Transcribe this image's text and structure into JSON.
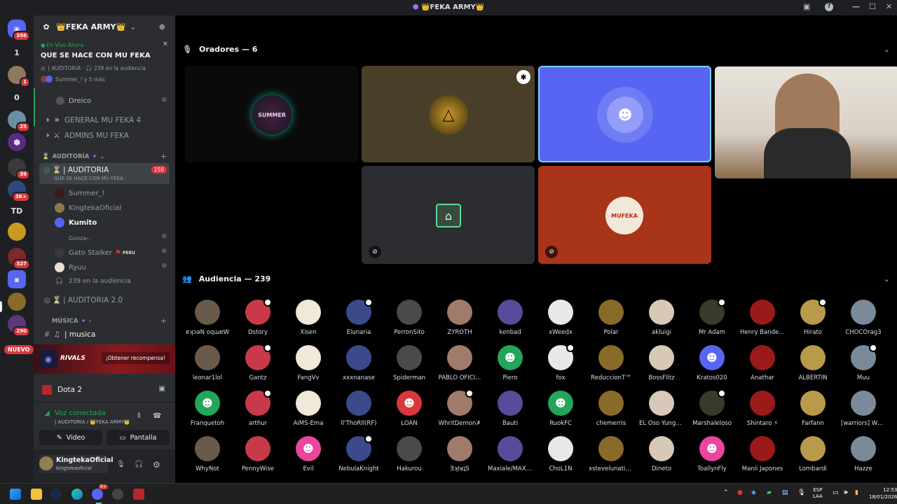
{
  "window": {
    "title": "👑FEKA ARMY👑"
  },
  "server": {
    "name": "👑FEKA ARMY👑"
  },
  "live": {
    "label": "En Vivo Ahora",
    "title": "QUE SE HACE CON MU FEKA",
    "meta": "| AUDITORIA · 🎧 239 en la audiencia",
    "others": "Summer_! y 5 más"
  },
  "server_badges": [
    "356",
    "1",
    "25",
    "39",
    "3K+",
    "327",
    "290"
  ],
  "dm_count_1": "1",
  "dm_count_2": "0",
  "server_td": "TD",
  "nuevo_label": "NUEVO",
  "channels": {
    "sub_user_top": "Dreico",
    "ch1": "GENERAL MU FEKA 4",
    "ch2": "ADMINS MU FEKA",
    "cat_auditoria": "AUDITORÍA",
    "stage": "| AUDITORIA",
    "stage_badge": "150",
    "stage_topic": "QUE SE HACE CON MU FEKA",
    "stage_users": [
      "Summer_!",
      "KingtekaOficial",
      "Kumito",
      "Gonza-.",
      "Gato Stalker",
      "Ryuu"
    ],
    "peru_tag": "PERU",
    "audience_count": "239 en la audiencia",
    "stage2": "| AUDITORIA 2.0",
    "cat_musica": "MÚSICA",
    "ch_musica": "| musica"
  },
  "promo": {
    "logo": "RIVALS",
    "button": "¡Obtener recompensa!"
  },
  "activity": {
    "game": "Dota 2"
  },
  "voice": {
    "status": "Voz conectada",
    "location": "| AUDITORIA / 👑FEKA ARMY👑",
    "video_label": "Video",
    "screen_label": "Pantalla"
  },
  "user": {
    "name": "KingtekaOficial",
    "handle": "kingtekaoficial"
  },
  "stage_main": {
    "speakers_header": "Oradores — 6",
    "audience_header": "Audiencia — 239",
    "tile_summer_text": "SUMMER",
    "tile_mufeka_text": "MUFEKA"
  },
  "audience": [
    "ɐʞɔǝN oqɯɐW",
    "Dstory",
    "Xisen",
    "Elunaria",
    "PerronSito",
    "ZYROTH",
    "kenbad",
    "xWeedx",
    "Polar",
    "akluigi",
    "Mr Adam",
    "Henry Bander...",
    "Hirato",
    "CHOCOrag3",
    "leonar1lol",
    "Gantz",
    "FangVv",
    "xxxnanase",
    "Spiderman",
    "PABLO OFICI...",
    "Piero",
    "fox",
    "ReduccionT™",
    "BossFlitz",
    "Kratos020",
    "Anathar",
    "ALBERTIN",
    "Muu",
    "Franquetoh",
    "arthur",
    "AiMS-Ema",
    "ll'ThoRll(RF)",
    "LOAN",
    "WhritDemon✗",
    "Bauti",
    "RuokFC",
    "chemerris",
    "EL Oso Yungu...",
    "Marshaleloso",
    "Shintaro ⚡",
    "Farfann",
    "[warriors] WA...",
    "WhyNot",
    "PennyWise",
    "Evil",
    "NebulaKnight",
    "Hakurou",
    "ƎʞIᴚʇS",
    "Maxiale/MAXI...",
    "ChoL1N",
    "xstevelunaticox",
    "Dineto",
    "ToallynFly",
    "Manii Japones",
    "Lombardi",
    "Hazze"
  ],
  "taskbar": {
    "lang": "ESP",
    "layout": "LAA",
    "time": "12:53",
    "date": "18/01/2026",
    "discord_badge": "9+"
  },
  "colors": {
    "blurple": "#5865f2",
    "green": "#23a55a",
    "red": "#da373c",
    "bg_dark": "#1e1f22",
    "bg_mid": "#2b2d31"
  }
}
